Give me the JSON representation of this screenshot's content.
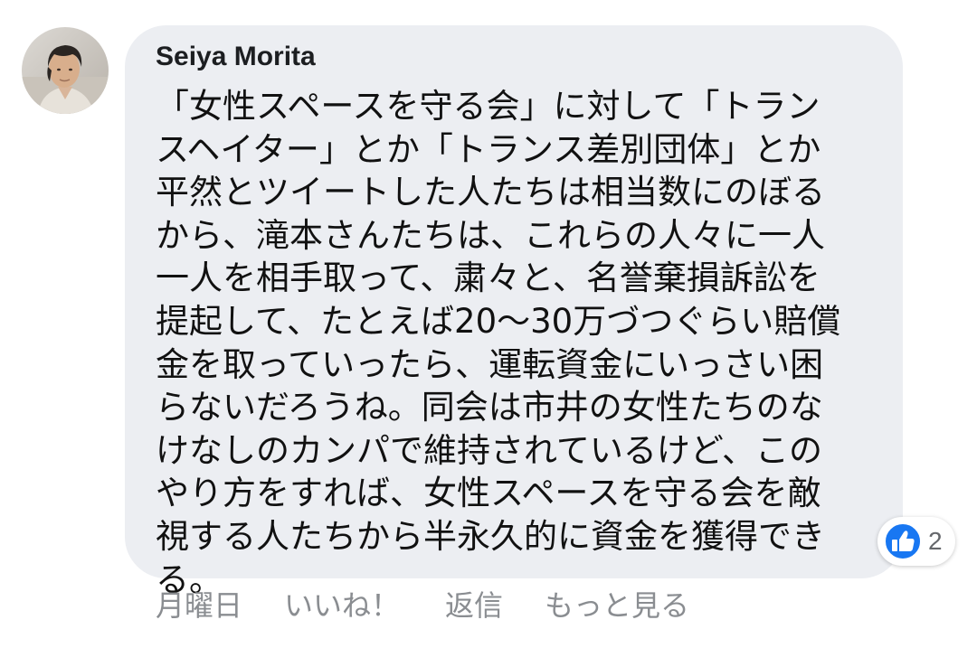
{
  "comment": {
    "author": "Seiya Morita",
    "text_lines": [
      "「女性スペースを守る会」に対して「トラン",
      "スヘイター」とか「トランス差別団体」とか",
      "平然とツイートした人たちは相当数にのぼる",
      "から、滝本さんたちは、これらの人々に一人",
      "一人を相手取って、粛々と、名誉棄損訴訟を",
      "提起して、たとえば20～30万づつぐらい賠償",
      "金を取っていったら、運転資金にいっさい困",
      "らないだろうね。同会は市井の女性たちのな",
      "けなしのカンパで維持されているけど、この",
      "やり方をすれば、女性スペースを守る会を敵",
      "視する人たちから半永久的に資金を獲得でき",
      "る。"
    ],
    "reaction": {
      "icon": "like-icon",
      "count": "2",
      "color": "#1877f2"
    },
    "actions": {
      "time": "月曜日",
      "like": "いいね！",
      "reply": "返信",
      "more": "もっと見る"
    }
  },
  "colors": {
    "bubble": "#eceef2",
    "text": "#111111",
    "meta": "#8a8d91",
    "like_blue": "#1877f2"
  }
}
